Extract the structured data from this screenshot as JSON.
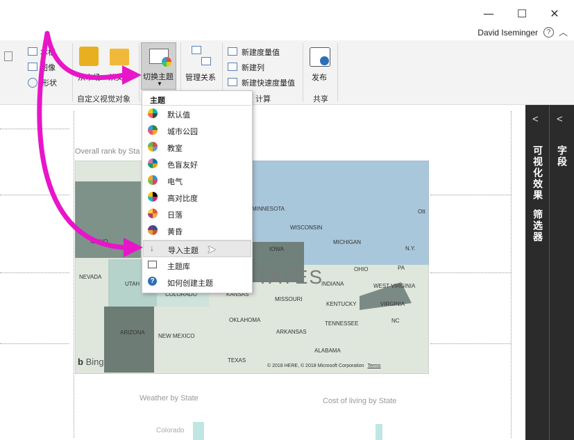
{
  "window": {
    "minimize_glyph": "—",
    "maximize_glyph": "☐",
    "close_glyph": "✕",
    "user_name": "David Iseminger",
    "help_glyph": "?",
    "collapse_glyph": "︿"
  },
  "ribbon": {
    "text_box_label": "本框",
    "image_label": "图像",
    "shapes_label": "形状",
    "from_market_label": "从市场",
    "from_file_label": "从文",
    "custom_visuals_group": "自定义视觉对象",
    "switch_theme_label": "切换主题",
    "manage_relationships_label": "管理关系",
    "new_measure_label": "新建度量值",
    "new_column_label": "新建列",
    "new_quick_measure_label": "新建快速度量值",
    "calculations_group": "计算",
    "publish_label": "发布",
    "share_group": "共享"
  },
  "theme_menu": {
    "header": "主题",
    "themes": [
      {
        "label": "默认值",
        "colors": [
          "#01b8aa",
          "#374649",
          "#fd625e",
          "#f2c80f"
        ]
      },
      {
        "label": "城市公园",
        "colors": [
          "#2c8a3c",
          "#f0a92d",
          "#e8566c",
          "#3b9bd6"
        ]
      },
      {
        "label": "教室",
        "colors": [
          "#e44a3c",
          "#4aa3df",
          "#f4b400",
          "#5cb85c"
        ]
      },
      {
        "label": "色盲友好",
        "colors": [
          "#0072b2",
          "#e69f00",
          "#009e73",
          "#cc79a7"
        ]
      },
      {
        "label": "电气",
        "colors": [
          "#2f8fdd",
          "#e43f6f",
          "#7ac142",
          "#f5a623"
        ]
      },
      {
        "label": "高对比度",
        "colors": [
          "#000000",
          "#e91e63",
          "#00bcd4",
          "#ffc107"
        ]
      },
      {
        "label": "日落",
        "colors": [
          "#e8553c",
          "#f4a742",
          "#b23a6b",
          "#f7d04a"
        ]
      },
      {
        "label": "黄昏",
        "colors": [
          "#3b4a8c",
          "#c8563b",
          "#e3a23b",
          "#6b3b8c"
        ]
      }
    ],
    "import_label": "导入主题",
    "gallery_label": "主题库",
    "howto_label": "如何创建主题"
  },
  "panes": {
    "visualizations": "可视化效果",
    "filters": "筛选器",
    "fields": "字段",
    "collapse_glyph": "<"
  },
  "report": {
    "map_title": "Overall rank by Sta",
    "weather_title": "Weather by State",
    "cost_title": "Cost of living by State",
    "partial_label": "Colorado"
  },
  "map": {
    "bing_label": "Bing",
    "copyright": "© 2018 HERE, © 2018 Microsoft Corporation",
    "terms": "Terms",
    "big_label": "TATES",
    "states": [
      "MINNESOTA",
      "WISCONSIN",
      "MICHIGAN",
      "IOWA",
      "IDAHO",
      "NEVADA",
      "UTAH",
      "COLORADO",
      "KANSAS",
      "MISSOURI",
      "INDIANA",
      "OHIO",
      "PA",
      "N.Y.",
      "WEST VIRGINIA",
      "VIRGINIA",
      "KENTUCKY",
      "NC",
      "TENNESSEE",
      "OKLAHOMA",
      "ARKANSAS",
      "NEW MEXICO",
      "ARIZONA",
      "TEXAS",
      "ALABAMA",
      "Ott"
    ]
  }
}
